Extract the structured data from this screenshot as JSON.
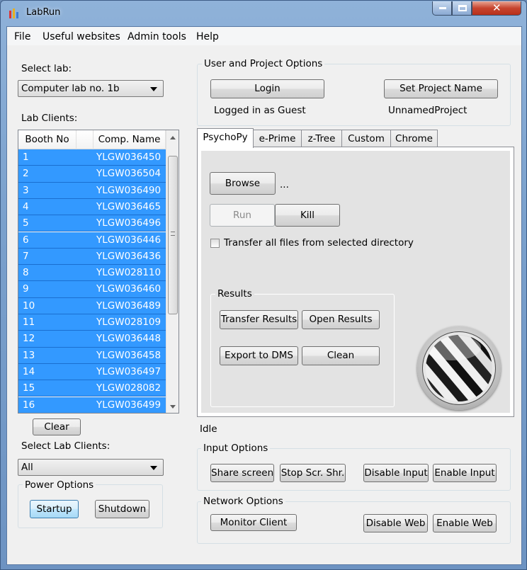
{
  "window": {
    "title": "LabRun"
  },
  "menu": [
    "File",
    "Useful websites",
    "Admin tools",
    "Help"
  ],
  "left": {
    "select_lab_label": "Select lab:",
    "select_lab_value": "Computer lab no. 1b",
    "lab_clients_label": "Lab Clients:",
    "grid_headers": [
      "Booth No",
      "Comp. Name"
    ],
    "rows": [
      {
        "booth": "1",
        "name": "YLGW036450"
      },
      {
        "booth": "2",
        "name": "YLGW036504"
      },
      {
        "booth": "3",
        "name": "YLGW036490"
      },
      {
        "booth": "4",
        "name": "YLGW036465"
      },
      {
        "booth": "5",
        "name": "YLGW036496"
      },
      {
        "booth": "6",
        "name": "YLGW036446"
      },
      {
        "booth": "7",
        "name": "YLGW036436"
      },
      {
        "booth": "8",
        "name": "YLGW028110"
      },
      {
        "booth": "9",
        "name": "YLGW036460"
      },
      {
        "booth": "10",
        "name": "YLGW036489"
      },
      {
        "booth": "11",
        "name": "YLGW028109"
      },
      {
        "booth": "12",
        "name": "YLGW036448"
      },
      {
        "booth": "13",
        "name": "YLGW036458"
      },
      {
        "booth": "14",
        "name": "YLGW036497"
      },
      {
        "booth": "15",
        "name": "YLGW028082"
      },
      {
        "booth": "16",
        "name": "YLGW036499"
      }
    ],
    "clear_button": "Clear",
    "select_clients_label": "Select Lab Clients:",
    "select_clients_value": "All",
    "power_group": "Power Options",
    "startup_button": "Startup",
    "shutdown_button": "Shutdown"
  },
  "user_project": {
    "group": "User and Project Options",
    "login_button": "Login",
    "set_project_button": "Set Project Name",
    "logged_in_text": "Logged in as Guest",
    "project_text": "UnnamedProject"
  },
  "tabs": [
    "PsychoPy",
    "e-Prime",
    "z-Tree",
    "Custom",
    "Chrome"
  ],
  "psychopy": {
    "browse_button": "Browse",
    "path_text": "...",
    "run_button": "Run",
    "kill_button": "Kill",
    "transfer_checkbox_label": "Transfer all files from selected directory",
    "results_group": "Results",
    "transfer_results_button": "Transfer Results",
    "open_results_button": "Open Results",
    "export_dms_button": "Export to DMS",
    "clean_button": "Clean"
  },
  "status_text": "Idle",
  "input_options": {
    "group": "Input Options",
    "share_screen_button": "Share screen",
    "stop_share_button": "Stop Scr. Shr.",
    "disable_input_button": "Disable Input",
    "enable_input_button": "Enable Input"
  },
  "network_options": {
    "group": "Network Options",
    "monitor_client_button": "Monitor Client",
    "disable_web_button": "Disable Web",
    "enable_web_button": "Enable Web"
  }
}
